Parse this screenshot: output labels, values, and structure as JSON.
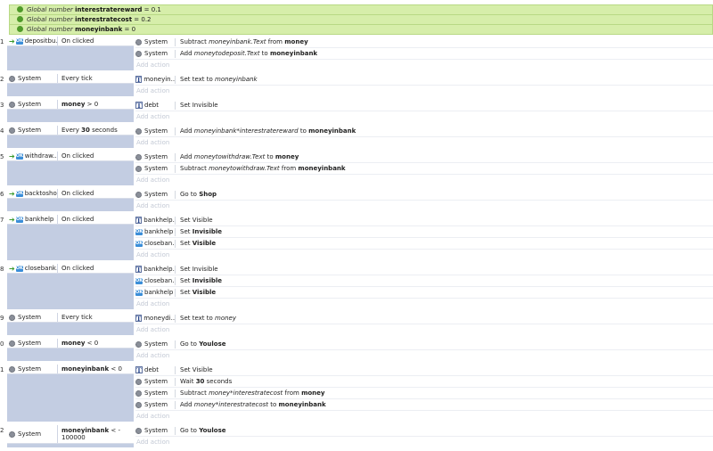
{
  "globals": [
    {
      "prefix": "Global number",
      "name": "interestratereward",
      "value": "= 0.1"
    },
    {
      "prefix": "Global number",
      "name": "interestratecost",
      "value": "= 0.2"
    },
    {
      "prefix": "Global number",
      "name": "moneyinbank",
      "value": "= 0"
    }
  ],
  "add_action_label": "Add action",
  "events": [
    {
      "num": "1",
      "trigger": true,
      "obj_icon": "button",
      "obj": "depositbu...",
      "cond": "On clicked",
      "actions": [
        {
          "icon": "gear",
          "obj": "System",
          "parts": [
            [
              "n",
              "Subtract "
            ],
            [
              "i",
              "moneyinbank.Text"
            ],
            [
              "n",
              " from "
            ],
            [
              "b",
              "money"
            ]
          ]
        },
        {
          "icon": "gear",
          "obj": "System",
          "parts": [
            [
              "n",
              "Add "
            ],
            [
              "i",
              "moneytodeposit.Text"
            ],
            [
              "n",
              " to "
            ],
            [
              "b",
              "moneyinbank"
            ]
          ]
        }
      ]
    },
    {
      "num": "2",
      "trigger": false,
      "obj_icon": "gear",
      "obj": "System",
      "cond_parts": [
        [
          "n",
          "Every tick"
        ]
      ],
      "actions": [
        {
          "icon": "text",
          "obj": "moneyin...",
          "parts": [
            [
              "n",
              "Set text to "
            ],
            [
              "i",
              "moneyinbank"
            ]
          ]
        }
      ]
    },
    {
      "num": "3",
      "trigger": false,
      "obj_icon": "gear",
      "obj": "System",
      "cond_parts": [
        [
          "b",
          "money"
        ],
        [
          "n",
          " > 0"
        ]
      ],
      "actions": [
        {
          "icon": "text",
          "obj": "debt",
          "parts": [
            [
              "n",
              "Set Invisible"
            ]
          ]
        }
      ]
    },
    {
      "num": "4",
      "trigger": false,
      "obj_icon": "gear",
      "obj": "System",
      "cond_parts": [
        [
          "n",
          "Every "
        ],
        [
          "b",
          "30"
        ],
        [
          "n",
          " seconds"
        ]
      ],
      "actions": [
        {
          "icon": "gear",
          "obj": "System",
          "parts": [
            [
              "n",
              "Add "
            ],
            [
              "i",
              "moneyinbank*interestratereward"
            ],
            [
              "n",
              " to "
            ],
            [
              "b",
              "moneyinbank"
            ]
          ]
        }
      ]
    },
    {
      "num": "5",
      "trigger": true,
      "obj_icon": "button",
      "obj": "withdraw...",
      "cond": "On clicked",
      "actions": [
        {
          "icon": "gear",
          "obj": "System",
          "parts": [
            [
              "n",
              "Add "
            ],
            [
              "i",
              "moneytowithdraw.Text"
            ],
            [
              "n",
              " to "
            ],
            [
              "b",
              "money"
            ]
          ]
        },
        {
          "icon": "gear",
          "obj": "System",
          "parts": [
            [
              "n",
              "Subtract "
            ],
            [
              "i",
              "moneytowithdraw.Text"
            ],
            [
              "n",
              " from "
            ],
            [
              "b",
              "moneyinbank"
            ]
          ]
        }
      ]
    },
    {
      "num": "6",
      "trigger": true,
      "obj_icon": "button",
      "obj": "backtoshop",
      "cond": "On clicked",
      "actions": [
        {
          "icon": "gear",
          "obj": "System",
          "parts": [
            [
              "n",
              "Go to "
            ],
            [
              "b",
              "Shop"
            ]
          ]
        }
      ]
    },
    {
      "num": "7",
      "trigger": true,
      "obj_icon": "button",
      "obj": "bankhelp",
      "cond": "On clicked",
      "actions": [
        {
          "icon": "text",
          "obj": "bankhelp...",
          "parts": [
            [
              "n",
              "Set Visible"
            ]
          ]
        },
        {
          "icon": "button",
          "obj": "bankhelp",
          "parts": [
            [
              "n",
              "Set "
            ],
            [
              "b",
              "Invisible"
            ]
          ]
        },
        {
          "icon": "button",
          "obj": "closeban...",
          "parts": [
            [
              "n",
              "Set "
            ],
            [
              "b",
              "Visible"
            ]
          ]
        }
      ]
    },
    {
      "num": "8",
      "trigger": true,
      "obj_icon": "button",
      "obj": "closebank...",
      "cond": "On clicked",
      "actions": [
        {
          "icon": "text",
          "obj": "bankhelp...",
          "parts": [
            [
              "n",
              "Set Invisible"
            ]
          ]
        },
        {
          "icon": "button",
          "obj": "closeban...",
          "parts": [
            [
              "n",
              "Set "
            ],
            [
              "b",
              "Invisible"
            ]
          ]
        },
        {
          "icon": "button",
          "obj": "bankhelp",
          "parts": [
            [
              "n",
              "Set "
            ],
            [
              "b",
              "Visible"
            ]
          ]
        }
      ]
    },
    {
      "num": "9",
      "trigger": false,
      "obj_icon": "gear",
      "obj": "System",
      "cond_parts": [
        [
          "n",
          "Every tick"
        ]
      ],
      "actions": [
        {
          "icon": "text",
          "obj": "moneydi...",
          "parts": [
            [
              "n",
              "Set text to "
            ],
            [
              "i",
              "money"
            ]
          ]
        }
      ]
    },
    {
      "num": "0",
      "trigger": false,
      "obj_icon": "gear",
      "obj": "System",
      "cond_parts": [
        [
          "b",
          "money"
        ],
        [
          "n",
          " < 0"
        ]
      ],
      "actions": [
        {
          "icon": "gear",
          "obj": "System",
          "parts": [
            [
              "n",
              "Go to "
            ],
            [
              "b",
              "Youlose"
            ]
          ]
        }
      ]
    },
    {
      "num": "1",
      "trigger": false,
      "obj_icon": "gear",
      "obj": "System",
      "cond_parts": [
        [
          "b",
          "moneyinbank"
        ],
        [
          "n",
          " < 0"
        ]
      ],
      "actions": [
        {
          "icon": "text",
          "obj": "debt",
          "parts": [
            [
              "n",
              "Set Visible"
            ]
          ]
        },
        {
          "icon": "gear",
          "obj": "System",
          "parts": [
            [
              "n",
              "Wait "
            ],
            [
              "b",
              "30"
            ],
            [
              "n",
              " seconds"
            ]
          ]
        },
        {
          "icon": "gear",
          "obj": "System",
          "parts": [
            [
              "n",
              "Subtract "
            ],
            [
              "i",
              "money*interestratecost"
            ],
            [
              "n",
              " from "
            ],
            [
              "b",
              "money"
            ]
          ]
        },
        {
          "icon": "gear",
          "obj": "System",
          "parts": [
            [
              "n",
              "Add "
            ],
            [
              "i",
              "money*interestratecost"
            ],
            [
              "n",
              " to "
            ],
            [
              "b",
              "moneyinbank"
            ]
          ]
        }
      ]
    },
    {
      "num": "2",
      "trigger": false,
      "obj_icon": "gear",
      "obj": "System",
      "cond_parts": [
        [
          "b",
          "moneyinbank"
        ],
        [
          "n",
          " < -"
        ]
      ],
      "cond_line2": "100000",
      "actions": [
        {
          "icon": "gear",
          "obj": "System",
          "parts": [
            [
              "n",
              "Go to "
            ],
            [
              "b",
              "Youlose"
            ]
          ]
        }
      ]
    }
  ]
}
